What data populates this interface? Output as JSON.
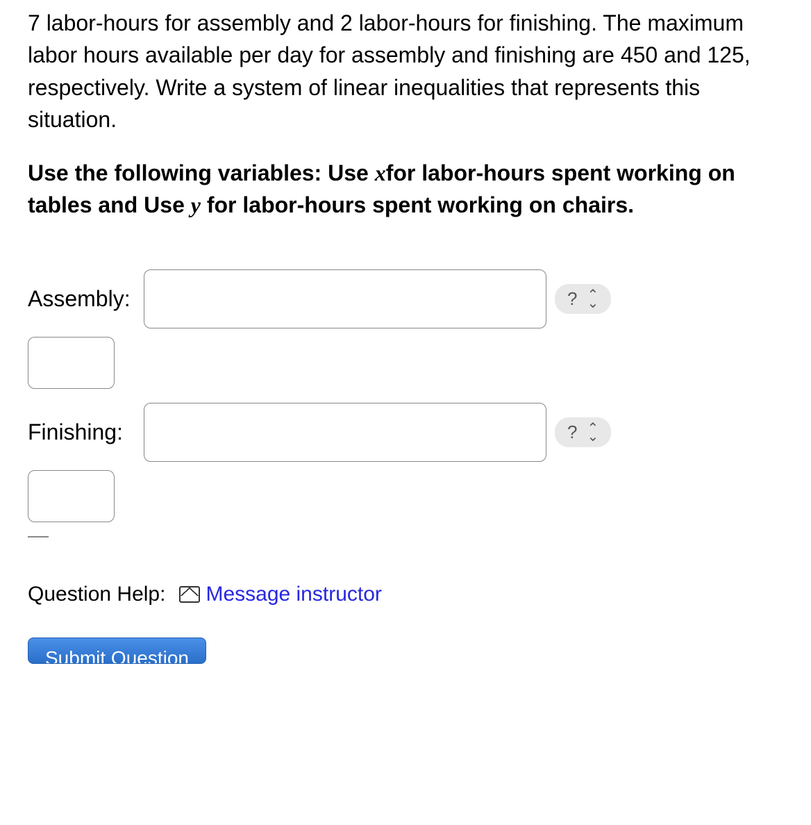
{
  "question": {
    "paragraph1": "7 labor-hours for assembly and 2 labor-hours for finishing. The maximum labor hours available per day for assembly and finishing are 450 and 125, respectively. Write a system of linear inequalities that represents this situation.",
    "paragraph2_prefix": "Use the following variables: Use ",
    "var1": "x",
    "paragraph2_mid1": "for labor-hours spent working on tables and Use ",
    "var2": "y",
    "paragraph2_suffix": " for labor-hours spent working on chairs."
  },
  "inputs": {
    "assembly_label": "Assembly:",
    "finishing_label": "Finishing:",
    "hint_symbol": "?"
  },
  "help": {
    "label": "Question Help:",
    "link_text": "Message instructor"
  },
  "submit": {
    "label": "Submit Question"
  }
}
